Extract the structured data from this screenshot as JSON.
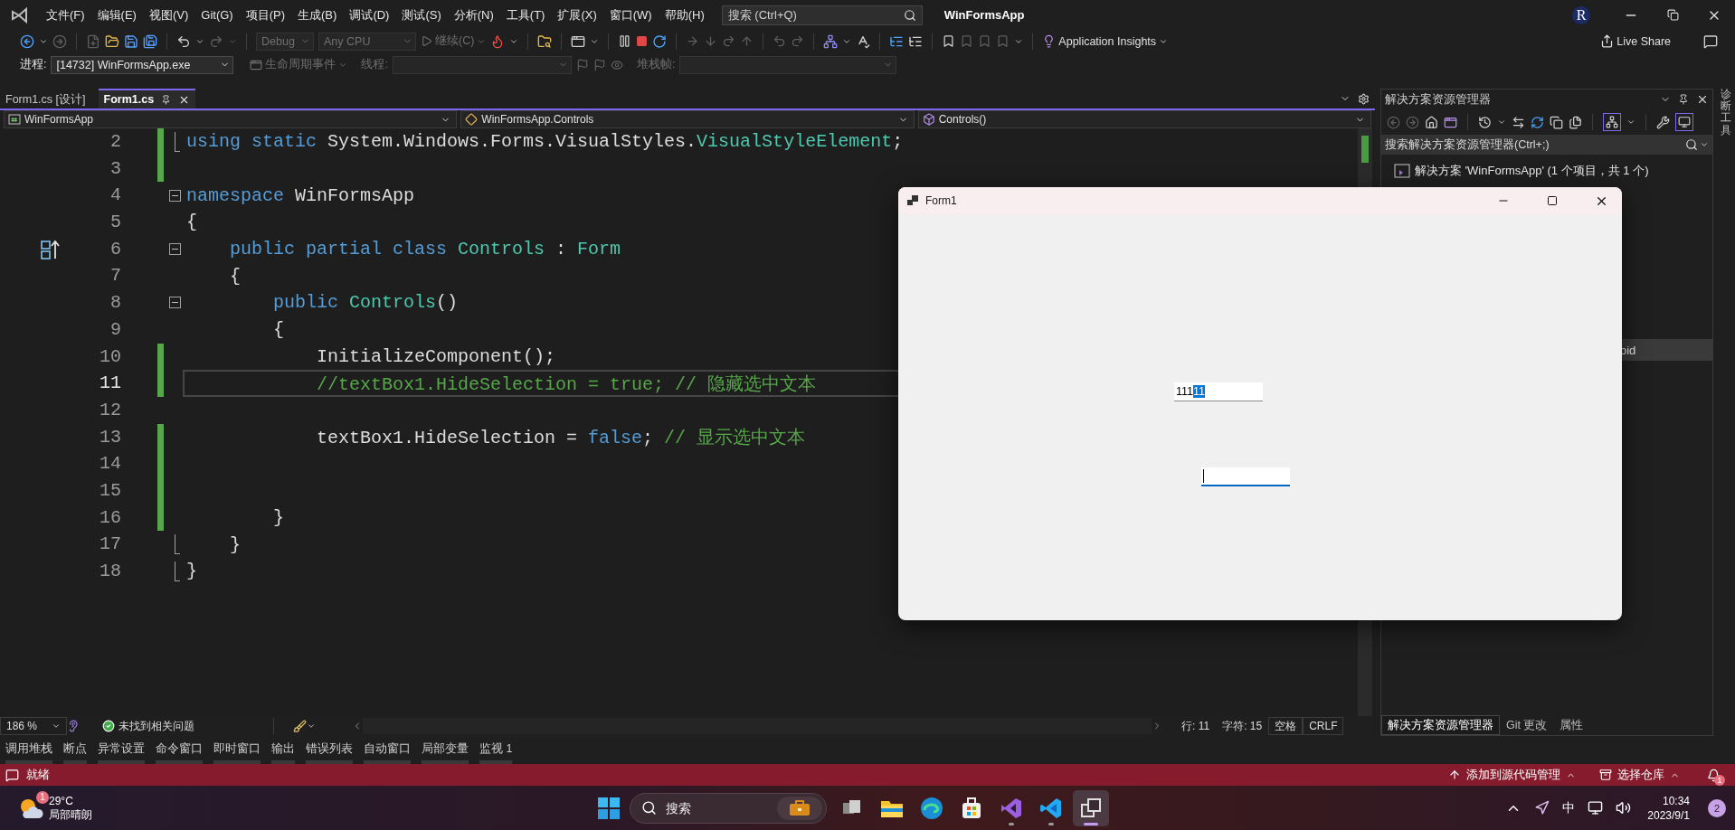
{
  "menu_bar": {
    "items": [
      "文件(F)",
      "编辑(E)",
      "视图(V)",
      "Git(G)",
      "项目(P)",
      "生成(B)",
      "调试(D)",
      "测试(S)",
      "分析(N)",
      "工具(T)",
      "扩展(X)",
      "窗口(W)",
      "帮助(H)"
    ],
    "search": {
      "placeholder": "搜索 (Ctrl+Q)"
    },
    "solution_name": "WinFormsApp",
    "account_initial": "R"
  },
  "toolbar": {
    "configuration": {
      "value": "Debug",
      "disabled": true
    },
    "platform": {
      "value": "Any CPU",
      "disabled": true
    },
    "continue": {
      "label": "继续(C)",
      "disabled": true
    },
    "application_insights": "Application Insights",
    "live_share": "Live Share"
  },
  "debug_toolbar": {
    "process_label": "进程:",
    "process": "[14732] WinFormsApp.exe",
    "lifecycle": {
      "label": "生命周期事件",
      "disabled": true
    },
    "thread": {
      "label": "线程:",
      "disabled": true
    },
    "stack_frame": {
      "label": "堆栈帧:",
      "disabled": true
    }
  },
  "document_tabs": [
    {
      "label": "Form1.cs [设计]",
      "selected": false
    },
    {
      "label": "Form1.cs",
      "selected": true
    }
  ],
  "navigation_bar": [
    {
      "kind": "project",
      "label": "WinFormsApp"
    },
    {
      "kind": "class",
      "label": "WinFormsApp.Controls"
    },
    {
      "kind": "method",
      "label": "Controls()"
    }
  ],
  "code_lines": [
    {
      "number": "2",
      "changed": true,
      "current": false,
      "block_end": true,
      "tokens": [
        {
          "kind": "keyword",
          "text": "using static"
        },
        {
          "kind": "plain",
          "text": " System.Windows.Forms.VisualStyles."
        },
        {
          "kind": "type",
          "text": "VisualStyleElement"
        },
        {
          "kind": "plain",
          "text": ";"
        }
      ]
    },
    {
      "number": "3",
      "changed": true,
      "current": false
    },
    {
      "number": "4",
      "changed": false,
      "current": false,
      "collapsible": true,
      "tokens": [
        {
          "kind": "keyword",
          "text": "namespace"
        },
        {
          "kind": "plain",
          "text": " WinFormsApp"
        }
      ]
    },
    {
      "number": "5",
      "changed": false,
      "current": false,
      "tokens": [
        {
          "kind": "plain",
          "text": "{"
        }
      ]
    },
    {
      "number": "6",
      "changed": false,
      "current": false,
      "collapsible": true,
      "inheritance_marker": true,
      "tokens": [
        {
          "kind": "keyword",
          "text": "    public partial class "
        },
        {
          "kind": "type",
          "text": "Controls"
        },
        {
          "kind": "plain",
          "text": " : "
        },
        {
          "kind": "type",
          "text": "Form"
        }
      ]
    },
    {
      "number": "7",
      "changed": false,
      "current": false,
      "tokens": [
        {
          "kind": "plain",
          "text": "    {"
        }
      ]
    },
    {
      "number": "8",
      "changed": false,
      "current": false,
      "collapsible": true,
      "tokens": [
        {
          "kind": "keyword",
          "text": "        public "
        },
        {
          "kind": "type",
          "text": "Controls"
        },
        {
          "kind": "plain",
          "text": "()"
        }
      ]
    },
    {
      "number": "9",
      "changed": false,
      "current": false,
      "tokens": [
        {
          "kind": "plain",
          "text": "        {"
        }
      ]
    },
    {
      "number": "10",
      "changed": true,
      "current": false,
      "tokens": [
        {
          "kind": "plain",
          "text": "            InitializeComponent();"
        }
      ]
    },
    {
      "number": "11",
      "changed": true,
      "current": true,
      "tokens": [
        {
          "kind": "comment",
          "text": "            //textBox1.HideSelection = true; // 隐藏选中文本"
        }
      ]
    },
    {
      "number": "12",
      "changed": false,
      "current": false
    },
    {
      "number": "13",
      "changed": true,
      "current": false,
      "tokens": [
        {
          "kind": "plain",
          "text": "            textBox1.HideSelection = "
        },
        {
          "kind": "keyword",
          "text": "false"
        },
        {
          "kind": "plain",
          "text": "; "
        },
        {
          "kind": "comment",
          "text": "// 显示选中文本"
        }
      ]
    },
    {
      "number": "14",
      "changed": true,
      "current": false
    },
    {
      "number": "15",
      "changed": true,
      "current": false
    },
    {
      "number": "16",
      "changed": true,
      "current": false,
      "tokens": [
        {
          "kind": "plain",
          "text": "        }"
        }
      ]
    },
    {
      "number": "17",
      "changed": false,
      "current": false,
      "block_end": true,
      "tokens": [
        {
          "kind": "plain",
          "text": "    }"
        }
      ]
    },
    {
      "number": "18",
      "changed": false,
      "current": false,
      "block_end": true,
      "tokens": [
        {
          "kind": "plain",
          "text": "}"
        }
      ]
    }
  ],
  "editor_status": {
    "zoom": "186 %",
    "issues": "未找到相关问题",
    "line": "行: 11",
    "column": "字符: 15",
    "whitespace": "空格",
    "line_ending": "CRLF"
  },
  "solution_explorer": {
    "title": "解决方案资源管理器",
    "search_placeholder": "搜索解决方案资源管理器(Ctrl+;)",
    "tree": [
      {
        "label": "解决方案 'WinFormsApp' (1 个项目，共 1 个)",
        "selected": false,
        "children": [
          {
            "label": "oid",
            "selected": true
          }
        ]
      }
    ],
    "tabs": [
      {
        "label": "解决方案资源管理器",
        "selected": true
      },
      {
        "label": "Git 更改",
        "selected": false
      },
      {
        "label": "属性",
        "selected": false
      }
    ]
  },
  "side_strip": {
    "label": "诊断工具"
  },
  "tool_tabs": [
    "调用堆栈",
    "断点",
    "异常设置",
    "命令窗口",
    "即时窗口",
    "输出",
    "错误列表",
    "自动窗口",
    "局部变量",
    "监视 1"
  ],
  "status_bar": {
    "message": "就绪",
    "source_control": "添加到源代码管理",
    "repository": "选择仓库",
    "notifications": "1"
  },
  "form_window": {
    "title": "Form1",
    "text_boxes": [
      {
        "value": "111",
        "selected_text": "11",
        "focused": false
      },
      {
        "focused": true
      }
    ]
  },
  "taskbar": {
    "weather": {
      "badge": "1",
      "temperature": "29°C",
      "condition": "局部晴朗"
    },
    "search_placeholder": "搜索",
    "apps": [
      {
        "kind": "task-view",
        "running": false,
        "active": false
      },
      {
        "kind": "files",
        "running": false,
        "active": false
      },
      {
        "kind": "browser",
        "running": false,
        "active": false
      },
      {
        "kind": "store",
        "running": false,
        "active": false
      },
      {
        "kind": "ide",
        "running": true,
        "active": false
      },
      {
        "kind": "editor",
        "running": true,
        "active": false
      },
      {
        "kind": "app",
        "running": true,
        "active": true
      }
    ],
    "ime": "中",
    "time": "10:34",
    "date": "2023/9/1",
    "notifications": "2"
  }
}
